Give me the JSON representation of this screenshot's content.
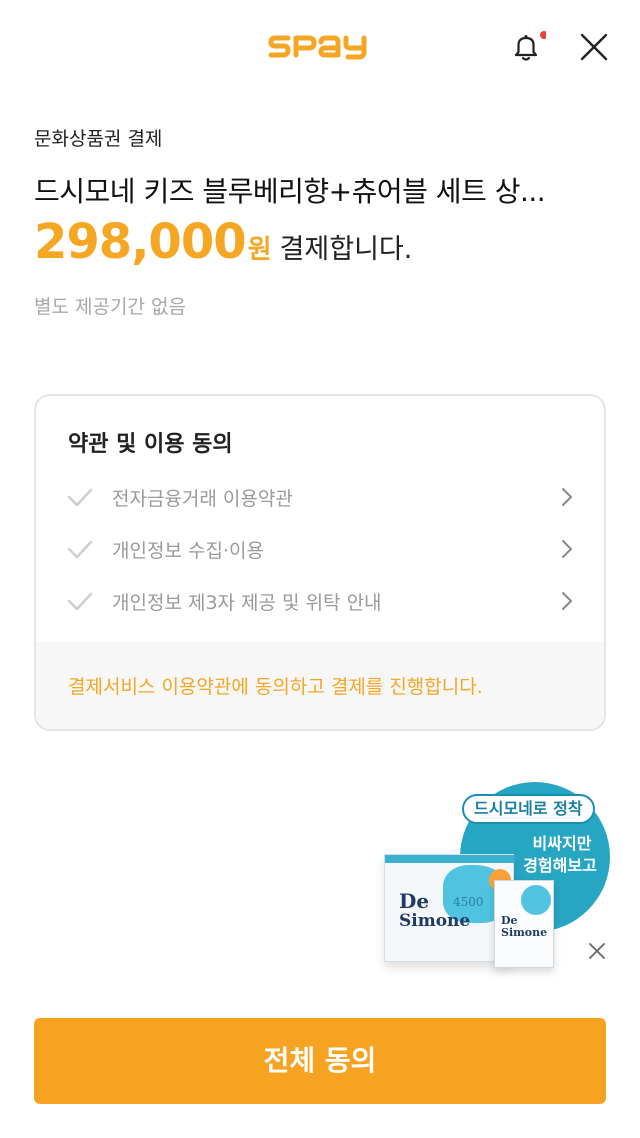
{
  "header": {
    "logo_text": "SPay",
    "notification_dot_color": "#e8433a",
    "brand_color": "#f5a623"
  },
  "payment": {
    "sub_title": "문화상품권 결제",
    "product_name": "드시모네 키즈 블루베리향+츄어블 세트 상...",
    "amount": "298,000",
    "currency_unit": "원",
    "amount_suffix": "결제합니다.",
    "period_note": "별도 제공기간 없음"
  },
  "terms": {
    "title": "약관 및 이용 동의",
    "items": [
      {
        "label": "전자금융거래 이용약관",
        "checked": false
      },
      {
        "label": "개인정보 수집·이용",
        "checked": false
      },
      {
        "label": "개인정보 제3자 제공 및 위탁 안내",
        "checked": false
      }
    ],
    "footer_notice": "결제서비스 이용약관에 동의하고 결제를 진행합니다."
  },
  "ad": {
    "tag": "드시모네로 정착",
    "line1": "비싸지만",
    "line2": "경험해보고",
    "brand_line1": "De",
    "brand_line2": "Simone",
    "product_number": "4500",
    "accent_color": "#27a6c4"
  },
  "cta": {
    "label": "전체 동의",
    "color": "#f7a322"
  }
}
